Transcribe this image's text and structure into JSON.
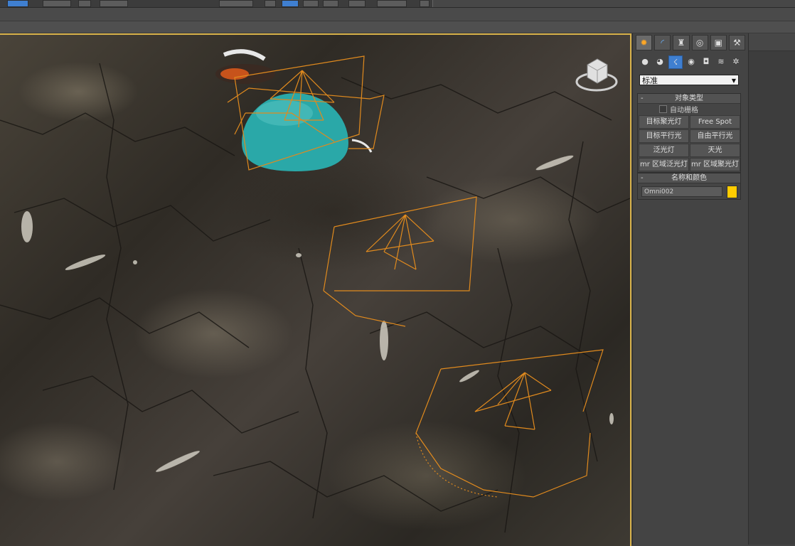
{
  "colors": {
    "viewport_border": "#d8b24a",
    "light_wire": "#e08a1e",
    "sphere": "#2aa8a8",
    "selected_button": "#3f7fd0",
    "name_swatch": "#ffcc00"
  },
  "toolbar": {
    "icons": [
      "select-icon",
      "link-icon",
      "unlink-icon",
      "bind-icon",
      "move-icon",
      "rotate-icon",
      "scale-icon",
      "snap-icon",
      "snap-toggle-icon",
      "mirror-icon",
      "align-icon",
      "layer-icon",
      "curve-editor-icon",
      "render-setup-icon",
      "render-icon"
    ]
  },
  "command_panel": {
    "tabs": [
      "create-icon",
      "modify-icon",
      "hierarchy-icon",
      "motion-icon",
      "display-icon",
      "utilities-icon"
    ],
    "subcategories": [
      "geometry-icon",
      "shapes-icon",
      "lights-icon",
      "cameras-icon",
      "helpers-icon",
      "spacewarps-icon",
      "systems-icon"
    ],
    "dropdown_value": "标准",
    "object_type": {
      "title": "对象类型",
      "autogrid_label": "自动栅格",
      "buttons": [
        "目标聚光灯",
        "Free Spot",
        "目标平行光",
        "自由平行光",
        "泛光灯",
        "天光",
        "mr 区域泛光灯",
        "mr 区域聚光灯"
      ]
    },
    "name_color": {
      "title": "名称和颜色",
      "name_value": "Omni002"
    }
  },
  "viewcube": {
    "label": "viewcube-icon"
  }
}
